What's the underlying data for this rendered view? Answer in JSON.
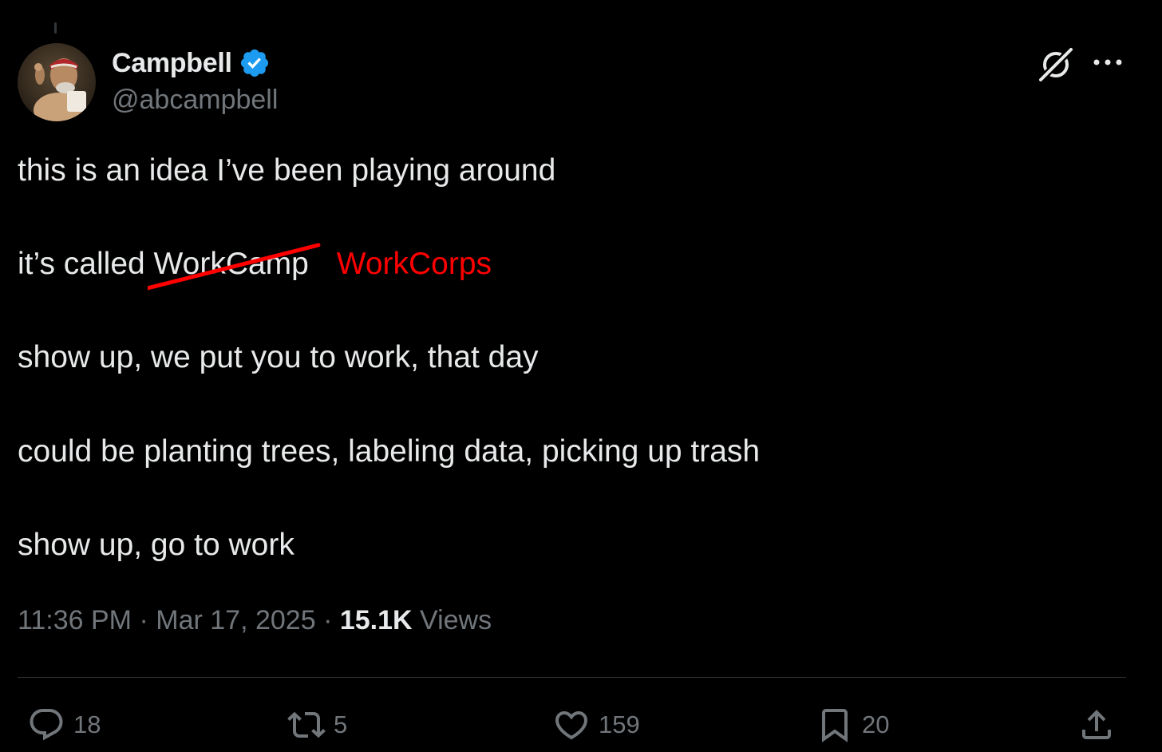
{
  "author": {
    "display_name": "Campbell",
    "handle": "@abcampbell",
    "verified": true,
    "verified_color": "#1d9bf0"
  },
  "tweet": {
    "lines": [
      "this is an idea I’ve been playing around",
      "it’s called",
      "show up, we put you to work, that day",
      "could be planting trees, labeling data, picking up trash",
      "show up, go to work"
    ],
    "struck_word": "WorkCamp",
    "correction_word": "WorkCorps",
    "correction_color": "#ff0000"
  },
  "meta": {
    "time": "11:36 PM",
    "separator": "·",
    "date": "Mar 17, 2025",
    "views_count": "15.1K",
    "views_label": "Views"
  },
  "actions": {
    "replies": "18",
    "reposts": "5",
    "likes": "159",
    "bookmarks": "20"
  },
  "icons": {
    "grok": "grok-icon",
    "more": "more-icon",
    "reply": "reply-icon",
    "repost": "repost-icon",
    "like": "heart-icon",
    "bookmark": "bookmark-icon",
    "share": "share-icon"
  },
  "colors": {
    "background": "#000000",
    "text": "#e7e9ea",
    "muted": "#71767b",
    "divider": "#2f3336"
  }
}
